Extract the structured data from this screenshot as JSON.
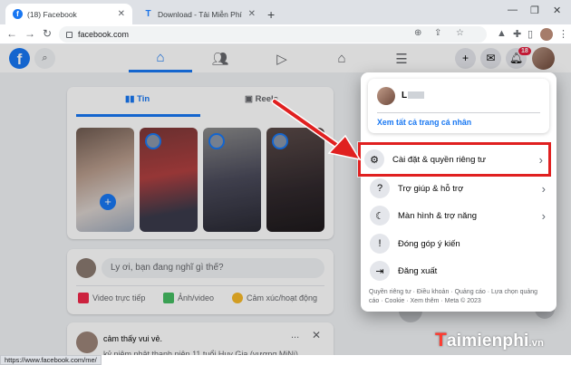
{
  "browser": {
    "tabs": [
      {
        "title": "(18) Facebook",
        "active": true
      },
      {
        "title": "Download - Tải Miễn Phí VN - Ph",
        "active": false
      }
    ],
    "new_tab_symbol": "+",
    "address": "facebook.com",
    "status_url": "https://www.facebook.com/me/"
  },
  "facebook": {
    "logo_letter": "f",
    "notification_count": "18",
    "stories_tabs": [
      "Tin",
      "Reels"
    ],
    "composer": {
      "placeholder": "Ly ơi, bạn đang nghĩ gì thế?",
      "actions": [
        "Video trực tiếp",
        "Ảnh/video",
        "Cảm xúc/hoạt động"
      ]
    },
    "post": {
      "line1": "cảm thấy vui vẻ.",
      "line2": "kỷ niệm nhật thanh niên 11 tuổi Huy Gia (vương MiNi)",
      "more": "...",
      "close": "✕"
    }
  },
  "account_menu": {
    "profile_name": "L",
    "see_profiles": "Xem tất cả trang cá nhân",
    "items": [
      {
        "icon": "gear-icon",
        "glyph": "⚙",
        "label": "Cài đặt & quyền riêng tư",
        "has_chevron": true,
        "highlighted": true
      },
      {
        "icon": "help-icon",
        "glyph": "?",
        "label": "Trợ giúp & hỗ trợ",
        "has_chevron": true,
        "highlighted": false
      },
      {
        "icon": "moon-icon",
        "glyph": "☾",
        "label": "Màn hình & trợ năng",
        "has_chevron": true,
        "highlighted": false
      },
      {
        "icon": "feedback-icon",
        "glyph": "!",
        "label": "Đóng góp ý kiến",
        "has_chevron": false,
        "highlighted": false
      },
      {
        "icon": "logout-icon",
        "glyph": "⇥",
        "label": "Đăng xuất",
        "has_chevron": false,
        "highlighted": false
      }
    ],
    "footer": "Quyền riêng tư · Điều khoản · Quảng cáo · Lựa chọn quảng cáo · Cookie · Xem thêm · Meta © 2023"
  },
  "watermark": {
    "lead": "T",
    "rest": "aimienphi",
    "suffix": ".vn"
  },
  "colors": {
    "facebook_blue": "#1877f2",
    "highlight_red": "#e02020",
    "badge_red": "#e41e3f"
  }
}
